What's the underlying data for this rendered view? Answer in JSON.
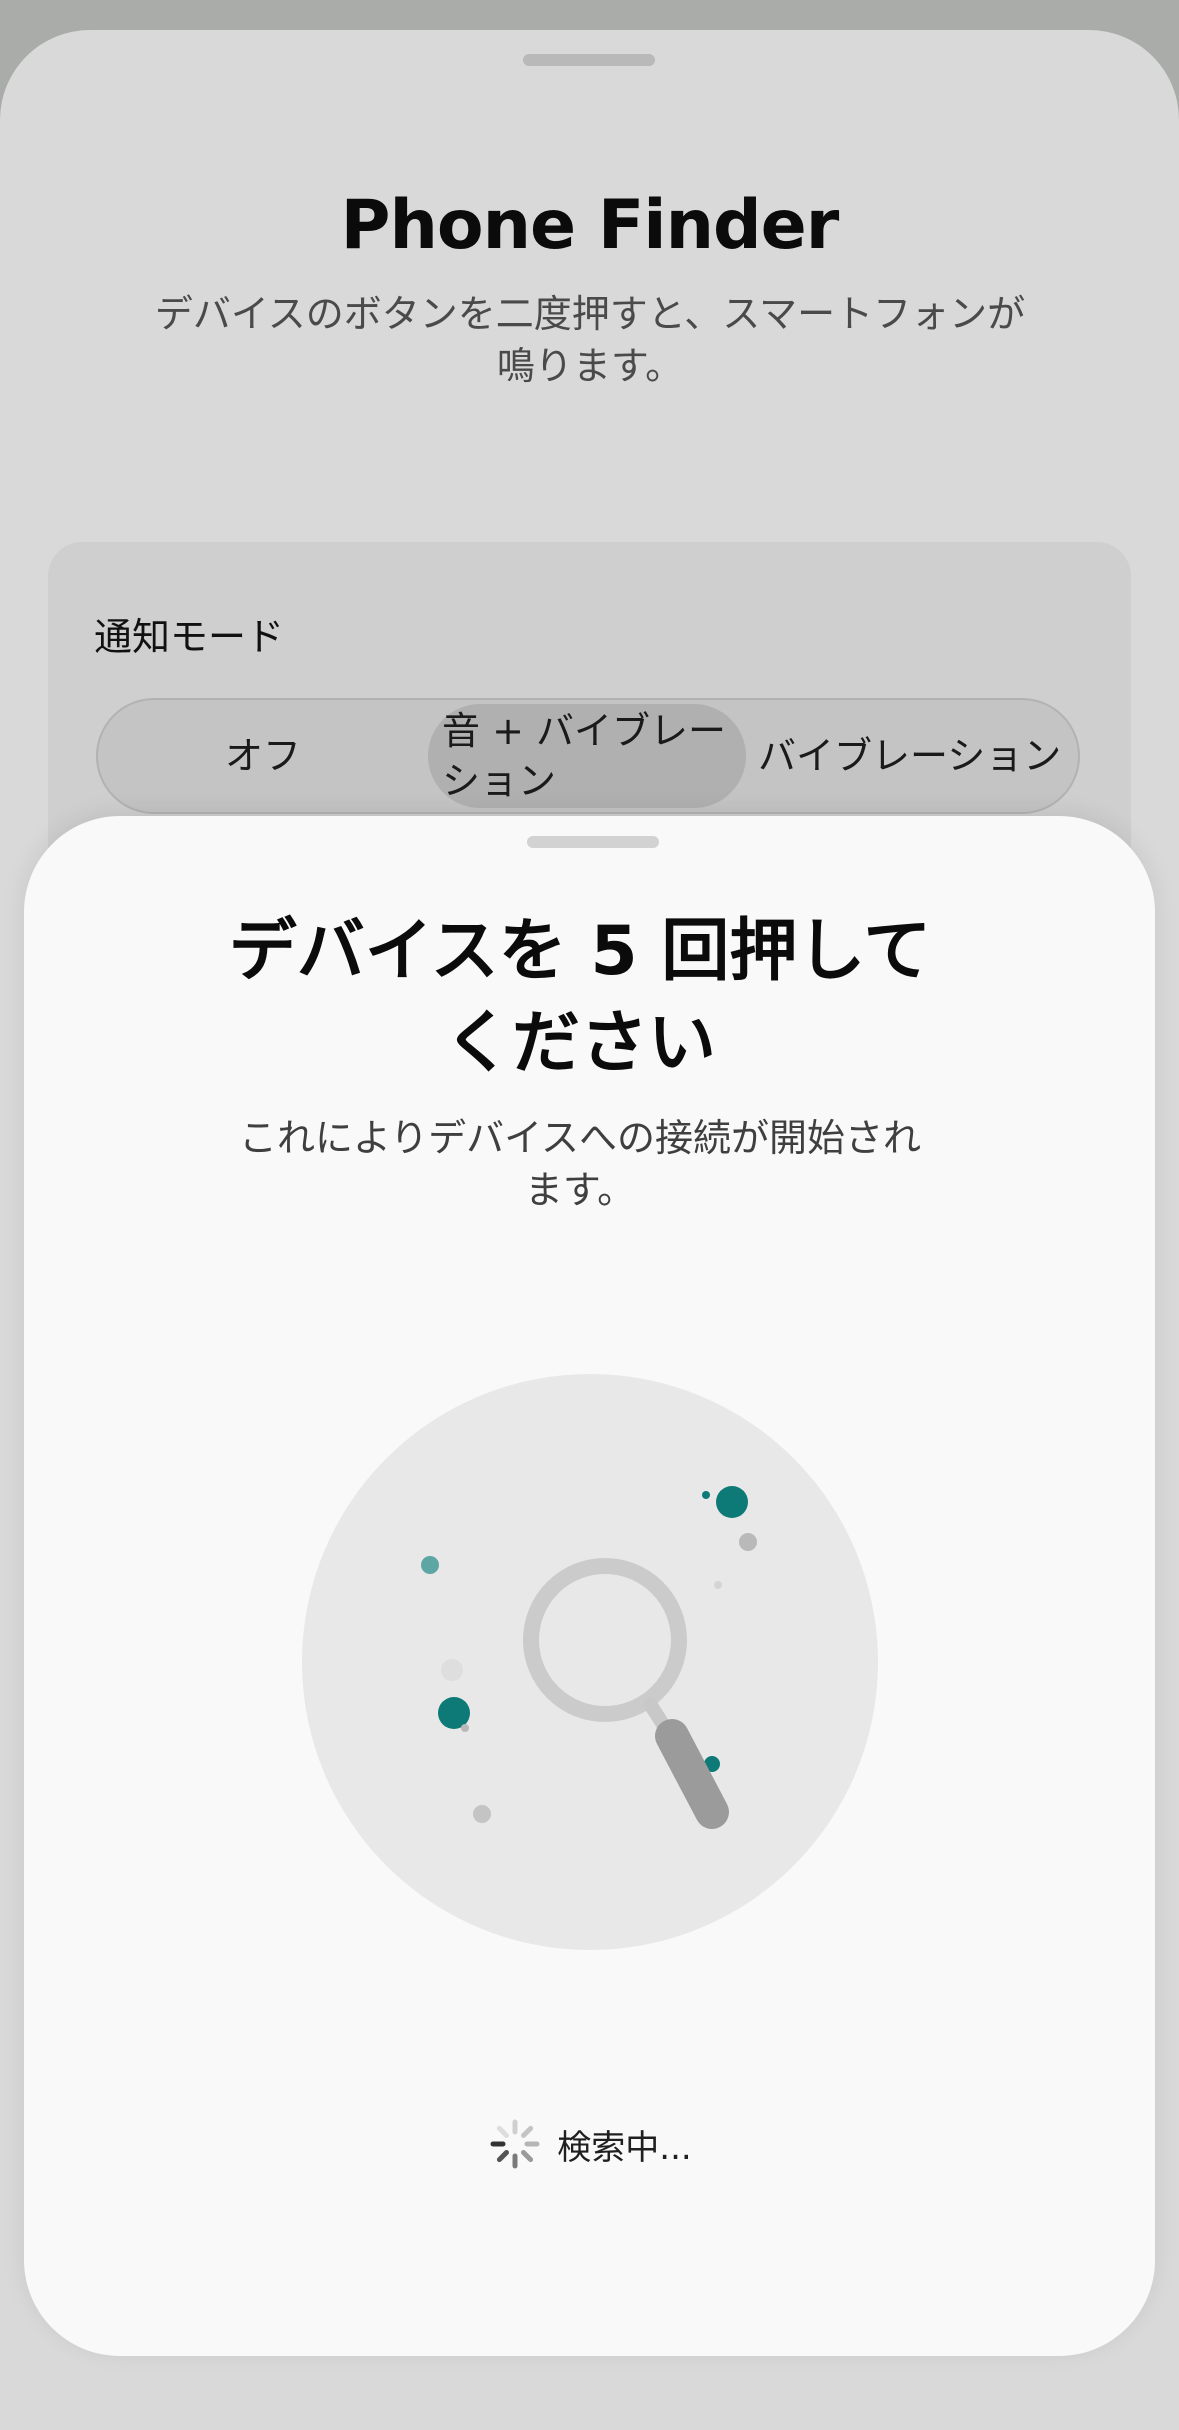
{
  "app": {
    "title": "Phone Finder",
    "subtitle": "デバイスのボタンを二度押すと、スマートフォンが鳴ります。"
  },
  "notification_mode": {
    "label": "通知モード",
    "options": [
      "オフ",
      "音 + バイブレーション",
      "バイブレーション"
    ],
    "selected": "音 + バイブレーション"
  },
  "dialog": {
    "title": "デバイスを 5 回押してください",
    "subtitle": "これによりデバイスへの接続が開始されます。",
    "status": "検索中..."
  },
  "colors": {
    "accent": "#0d7a78",
    "sheet_background": "#f9f9f9",
    "background_sheet": "#d9d9d9"
  },
  "icons": {
    "illustration": "magnifying-glass-icon",
    "status": "loading-spinner-icon"
  }
}
